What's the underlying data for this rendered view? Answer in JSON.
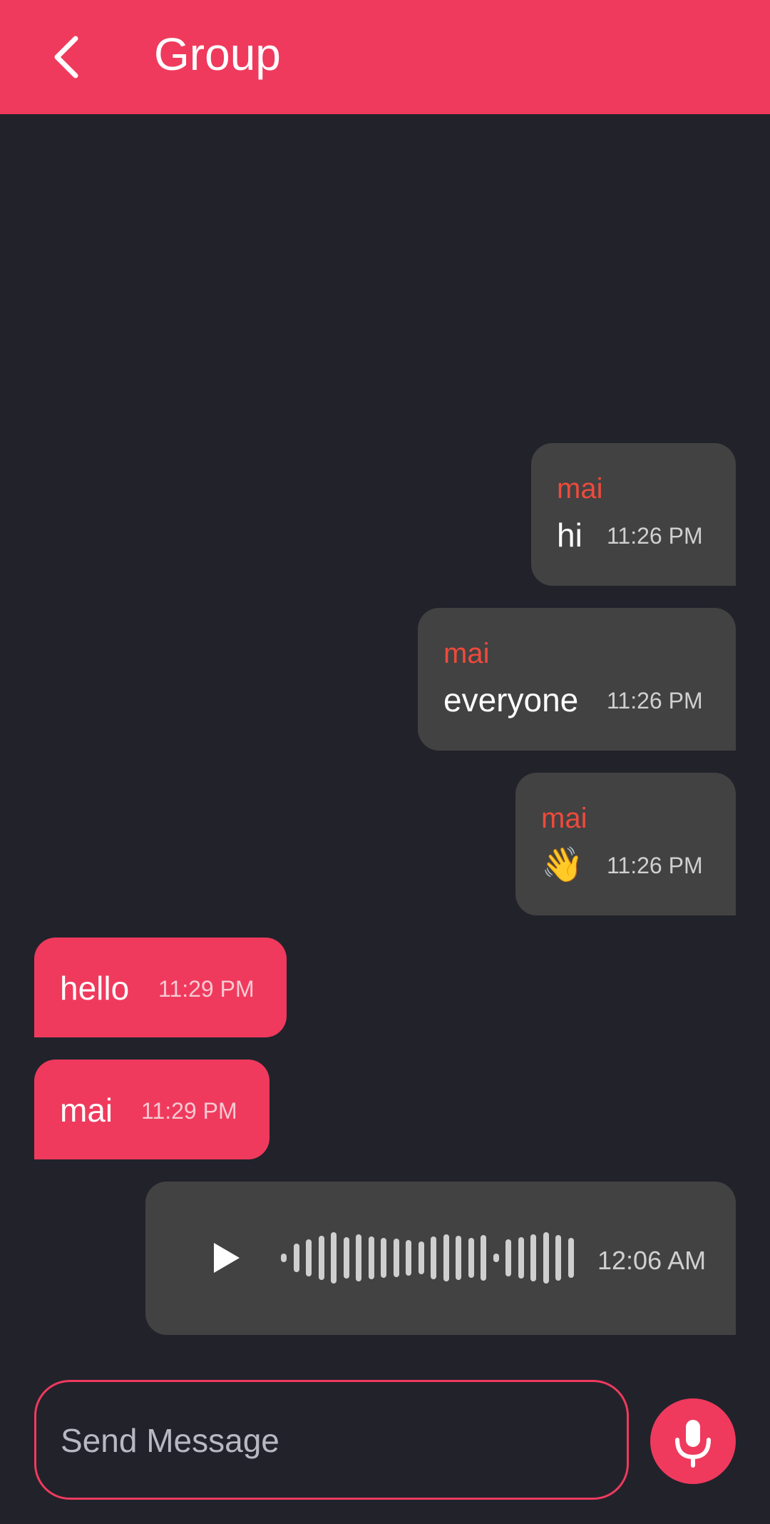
{
  "header": {
    "title": "Group"
  },
  "messages": [
    {
      "sender": "mai",
      "text": "hi",
      "time": "11:26 PM"
    },
    {
      "sender": "mai",
      "text": "everyone",
      "time": "11:26 PM"
    },
    {
      "sender": "mai",
      "text": "👋",
      "time": "11:26 PM"
    },
    {
      "text": "hello",
      "time": "11:29 PM"
    },
    {
      "text": "mai",
      "time": "11:29 PM"
    },
    {
      "time": "12:06 AM"
    }
  ],
  "composer": {
    "placeholder": "Send Message"
  },
  "icons": {
    "back": "chevron-left-icon",
    "play": "play-icon",
    "mic": "microphone-icon"
  },
  "colors": {
    "accent": "#ef3a5d",
    "background": "#22222b",
    "bubble_out": "#424242",
    "sender_name": "#ef4a3c"
  }
}
